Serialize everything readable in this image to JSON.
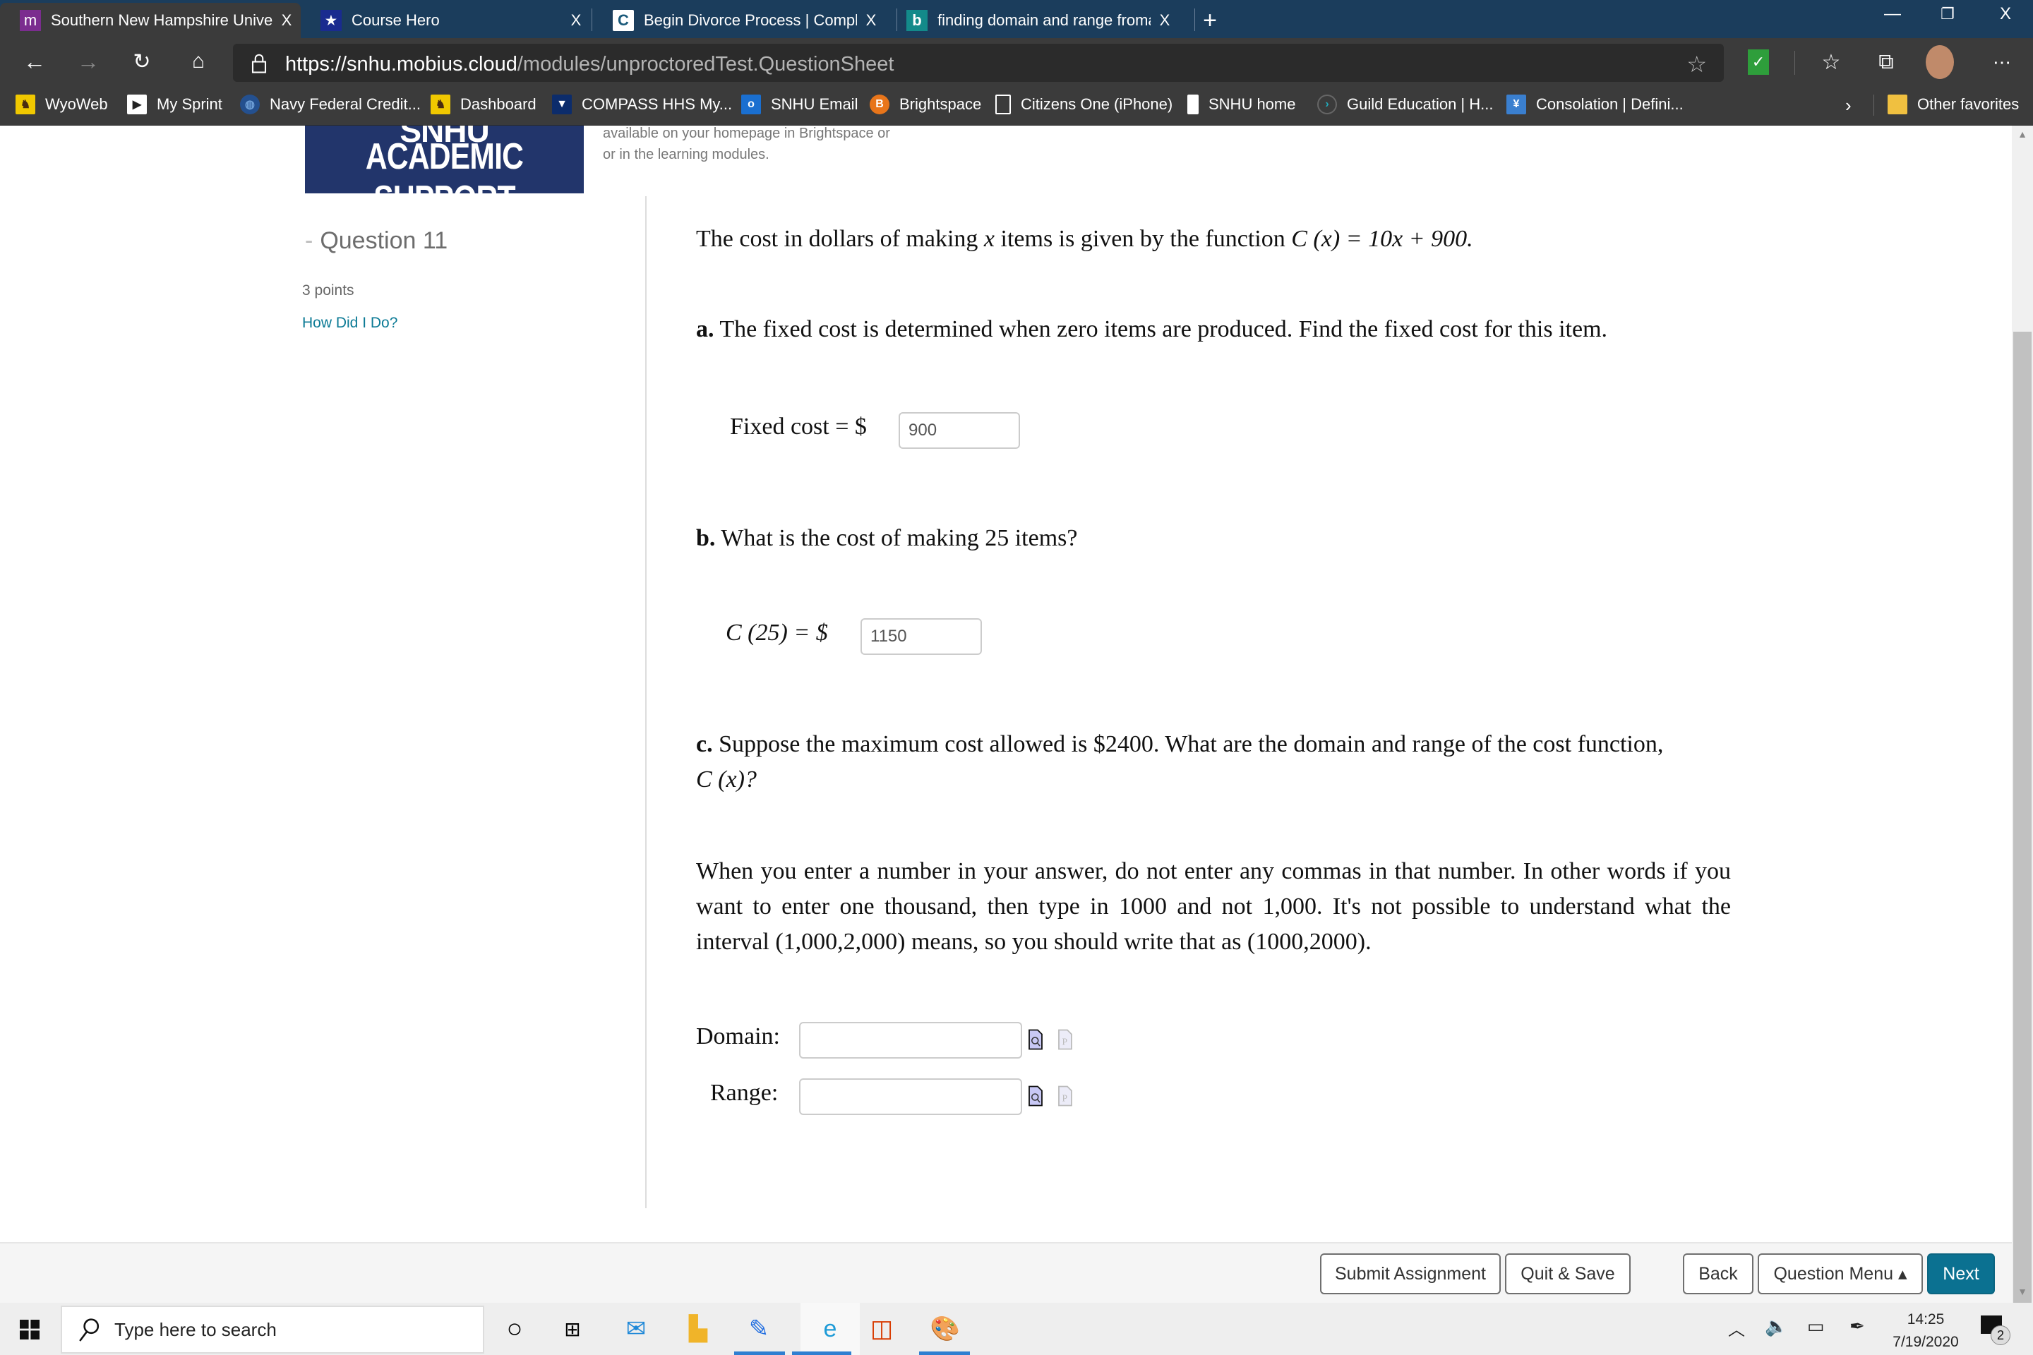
{
  "browser": {
    "tabs": [
      {
        "icon": "mobius-icon",
        "glyph": "m",
        "title": "Southern New Hampshire Univer",
        "active": true
      },
      {
        "icon": "course-hero-icon",
        "glyph": "★",
        "title": "Course Hero",
        "active": false
      },
      {
        "icon": "completecase-icon",
        "glyph": "C",
        "title": "Begin Divorce Process | Complet",
        "active": false
      },
      {
        "icon": "bing-icon",
        "glyph": "b",
        "title": "finding domain and range froma",
        "active": false
      }
    ],
    "new_tab_glyph": "+",
    "close_glyph": "X",
    "window_controls": {
      "minimize": "—",
      "restore": "❐",
      "close": "X"
    },
    "url_host": "https://snhu.mobius.cloud",
    "url_path": "/modules/unproctoredTest.QuestionSheet",
    "bookmarks": [
      {
        "label": "WyoWeb",
        "icon": "wyoming-icon"
      },
      {
        "label": "My Sprint",
        "icon": "sprint-icon"
      },
      {
        "label": "Navy Federal Credit...",
        "icon": "globe-icon"
      },
      {
        "label": "Dashboard",
        "icon": "wyoming-icon"
      },
      {
        "label": "COMPASS HHS My...",
        "icon": "compass-icon"
      },
      {
        "label": "SNHU Email",
        "icon": "outlook-icon"
      },
      {
        "label": "Brightspace",
        "icon": "brightspace-icon"
      },
      {
        "label": "Citizens One (iPhone)",
        "icon": "page-icon"
      },
      {
        "label": "SNHU home",
        "icon": "snhu-icon"
      },
      {
        "label": "Guild Education | H...",
        "icon": "guild-icon"
      },
      {
        "label": "Consolation | Defini...",
        "icon": "dictionary-icon"
      }
    ],
    "other_favorites": "Other favorites"
  },
  "page": {
    "banner": {
      "top_text": "SNHU",
      "main_text": "ACADEMIC SUPPORT"
    },
    "banner_note_line1": "available on your homepage in Brightspace or",
    "banner_note_line2": "or in the learning modules.",
    "question": {
      "heading_dash": "-",
      "heading": "Question 11",
      "points": "3 points",
      "how_did_i_do": "How Did I Do?"
    },
    "intro": {
      "prefix": "The cost in dollars of making ",
      "var": "x",
      "middle": " items is given by the function ",
      "func": "C (x) = 10x + 900."
    },
    "part_a": {
      "label": "a.",
      "text": " The fixed cost is determined when zero items are produced. Find the fixed cost for this item.",
      "answer_label": "Fixed cost = $",
      "answer_value": "900"
    },
    "part_b": {
      "label": "b.",
      "text": " What is the cost of making 25 items?",
      "answer_label": "C (25) = $",
      "answer_value": "1150"
    },
    "part_c": {
      "label": "c.",
      "text": " Suppose the maximum cost allowed is $2400. What are the domain and range of the cost function,",
      "text2": "C (x)?"
    },
    "instructions": "When you enter a number in your answer, do not enter any commas in that number. In other words if you want to enter one thousand, then type in 1000 and not 1,000. It's not possible to understand what the interval (1,000,2,000) means, so you should write that as (1000,2000).",
    "domain_label": "Domain:",
    "domain_value": "",
    "range_label": "Range:",
    "range_value": ""
  },
  "footer": {
    "submit": "Submit Assignment",
    "quit_save": "Quit & Save",
    "back": "Back",
    "question_menu": "Question Menu ▴",
    "next": "Next"
  },
  "taskbar": {
    "search_placeholder": "Type here to search",
    "time": "14:25",
    "date": "7/19/2020",
    "notifications": "2"
  },
  "colors": {
    "tabstrip": "#1b3d5c",
    "chrome": "#3b3b3b",
    "accent": "#0b7191",
    "link": "#0b7a95",
    "banner": "#22356b"
  }
}
